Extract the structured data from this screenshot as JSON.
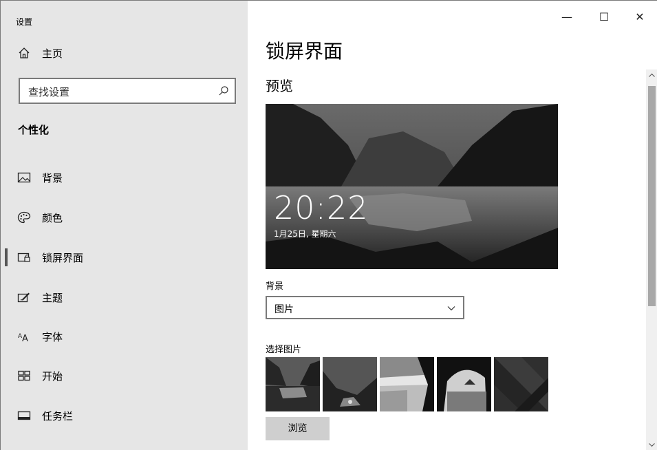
{
  "app": {
    "title": "设置"
  },
  "sidebar": {
    "home_label": "主页",
    "search_placeholder": "查找设置",
    "section_title": "个性化",
    "items": [
      {
        "label": "背景",
        "icon": "picture-icon"
      },
      {
        "label": "颜色",
        "icon": "palette-icon"
      },
      {
        "label": "锁屏界面",
        "icon": "lock-screen-icon",
        "active": true
      },
      {
        "label": "主题",
        "icon": "theme-icon"
      },
      {
        "label": "字体",
        "icon": "font-icon"
      },
      {
        "label": "开始",
        "icon": "start-icon"
      },
      {
        "label": "任务栏",
        "icon": "taskbar-icon"
      }
    ]
  },
  "window_controls": {
    "minimize": "—",
    "maximize": "☐",
    "close": "✕"
  },
  "main": {
    "page_title": "锁屏界面",
    "preview_title": "预览",
    "preview_time": "20:22",
    "preview_date": "1月25日, 星期六",
    "background_label": "背景",
    "background_value": "图片",
    "choose_label": "选择图片",
    "browse_label": "浏览"
  },
  "colors": {
    "sidebar_bg": "#e6e6e6",
    "active_marker": "#555555",
    "button_bg": "#cfcfcf"
  }
}
